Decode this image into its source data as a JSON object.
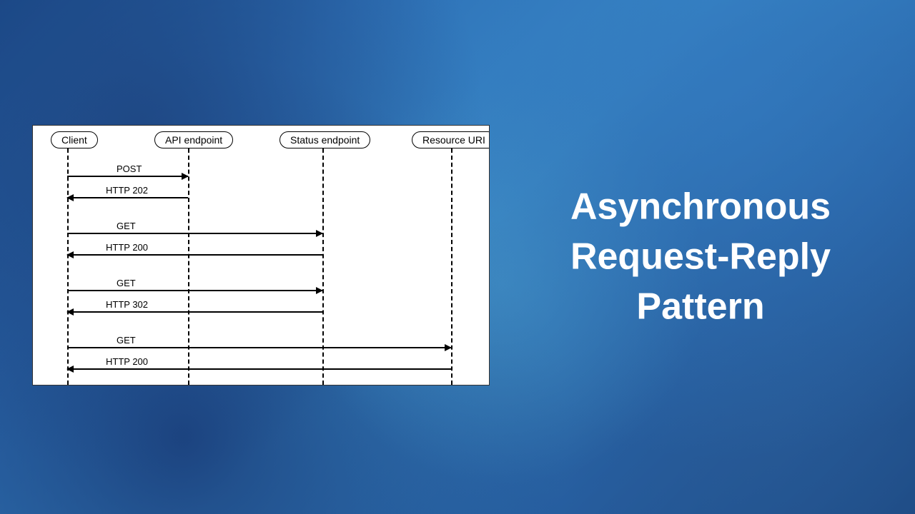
{
  "title_line1": "Asynchronous",
  "title_line2": "Request-Reply",
  "title_line3": "Pattern",
  "actors": {
    "client": "Client",
    "api": "API endpoint",
    "status": "Status endpoint",
    "resource": "Resource URI"
  },
  "messages": {
    "m1": "POST",
    "m2": "HTTP 202",
    "m3": "GET",
    "m4": "HTTP 200",
    "m5": "GET",
    "m6": "HTTP 302",
    "m7": "GET",
    "m8": "HTTP 200"
  },
  "sequence": [
    {
      "from": "Client",
      "to": "API endpoint",
      "label": "POST",
      "direction": "request"
    },
    {
      "from": "API endpoint",
      "to": "Client",
      "label": "HTTP 202",
      "direction": "response"
    },
    {
      "from": "Client",
      "to": "Status endpoint",
      "label": "GET",
      "direction": "request"
    },
    {
      "from": "Status endpoint",
      "to": "Client",
      "label": "HTTP 200",
      "direction": "response"
    },
    {
      "from": "Client",
      "to": "Status endpoint",
      "label": "GET",
      "direction": "request"
    },
    {
      "from": "Status endpoint",
      "to": "Client",
      "label": "HTTP 302",
      "direction": "response"
    },
    {
      "from": "Client",
      "to": "Resource URI",
      "label": "GET",
      "direction": "request"
    },
    {
      "from": "Resource URI",
      "to": "Client",
      "label": "HTTP 200",
      "direction": "response"
    }
  ]
}
